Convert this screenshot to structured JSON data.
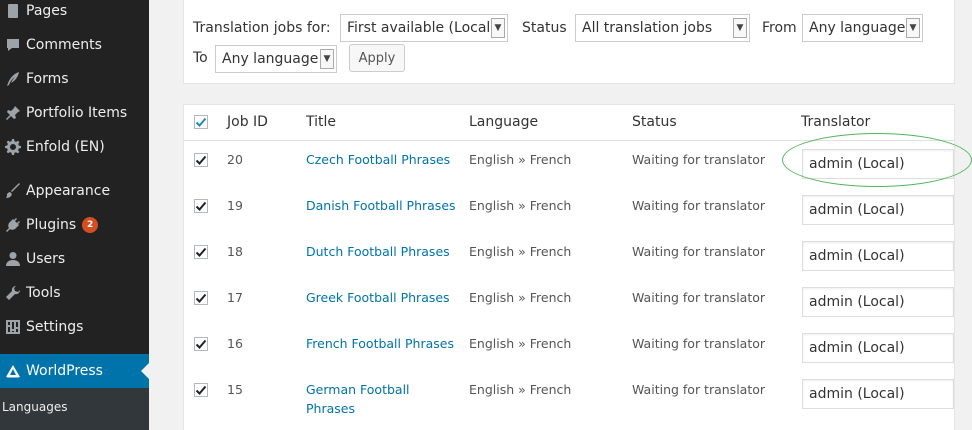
{
  "sidebar": {
    "items": [
      {
        "label": "Pages",
        "icon": "pages-icon"
      },
      {
        "label": "Comments",
        "icon": "comments-icon"
      },
      {
        "label": "Forms",
        "icon": "forms-icon"
      },
      {
        "label": "Portfolio Items",
        "icon": "pin-icon"
      },
      {
        "label": "Enfold (EN)",
        "icon": "gear-icon"
      },
      {
        "label": "Appearance",
        "icon": "brush-icon"
      },
      {
        "label": "Plugins",
        "icon": "plugin-icon",
        "badge": "2"
      },
      {
        "label": "Users",
        "icon": "user-icon"
      },
      {
        "label": "Tools",
        "icon": "wrench-icon"
      },
      {
        "label": "Settings",
        "icon": "settings-icon"
      },
      {
        "label": "WorldPress",
        "icon": "wpml-icon",
        "active": true
      }
    ],
    "submenu_label": "Languages"
  },
  "filters": {
    "jobs_for_label": "Translation jobs for:",
    "jobs_for_value": "First available (Local)",
    "status_label": "Status",
    "status_value": "All translation jobs",
    "from_label": "From",
    "from_value": "Any language",
    "to_label": "To",
    "to_value": "Any language",
    "apply_label": "Apply"
  },
  "table": {
    "headers": {
      "job_id": "Job ID",
      "title": "Title",
      "language": "Language",
      "status": "Status",
      "translator": "Translator"
    },
    "rows": [
      {
        "job_id": "20",
        "title": "Czech Football Phrases",
        "language": "English » French",
        "status": "Waiting for translator",
        "translator": "admin (Local)"
      },
      {
        "job_id": "19",
        "title": "Danish Football Phrases",
        "language": "English » French",
        "status": "Waiting for translator",
        "translator": "admin (Local)"
      },
      {
        "job_id": "18",
        "title": "Dutch Football Phrases",
        "language": "English » French",
        "status": "Waiting for translator",
        "translator": "admin (Local)"
      },
      {
        "job_id": "17",
        "title": "Greek Football Phrases",
        "language": "English » French",
        "status": "Waiting for translator",
        "translator": "admin (Local)"
      },
      {
        "job_id": "16",
        "title": "French Football Phrases",
        "language": "English » French",
        "status": "Waiting for translator",
        "translator": "admin (Local)"
      },
      {
        "job_id": "15",
        "title": "German Football Phrases",
        "language": "English » French",
        "status": "Waiting for translator",
        "translator": "admin (Local)"
      }
    ]
  },
  "colors": {
    "accent": "#0073aa",
    "sidebar": "#222222",
    "highlight": "#52b75a",
    "badge": "#d54e21"
  }
}
